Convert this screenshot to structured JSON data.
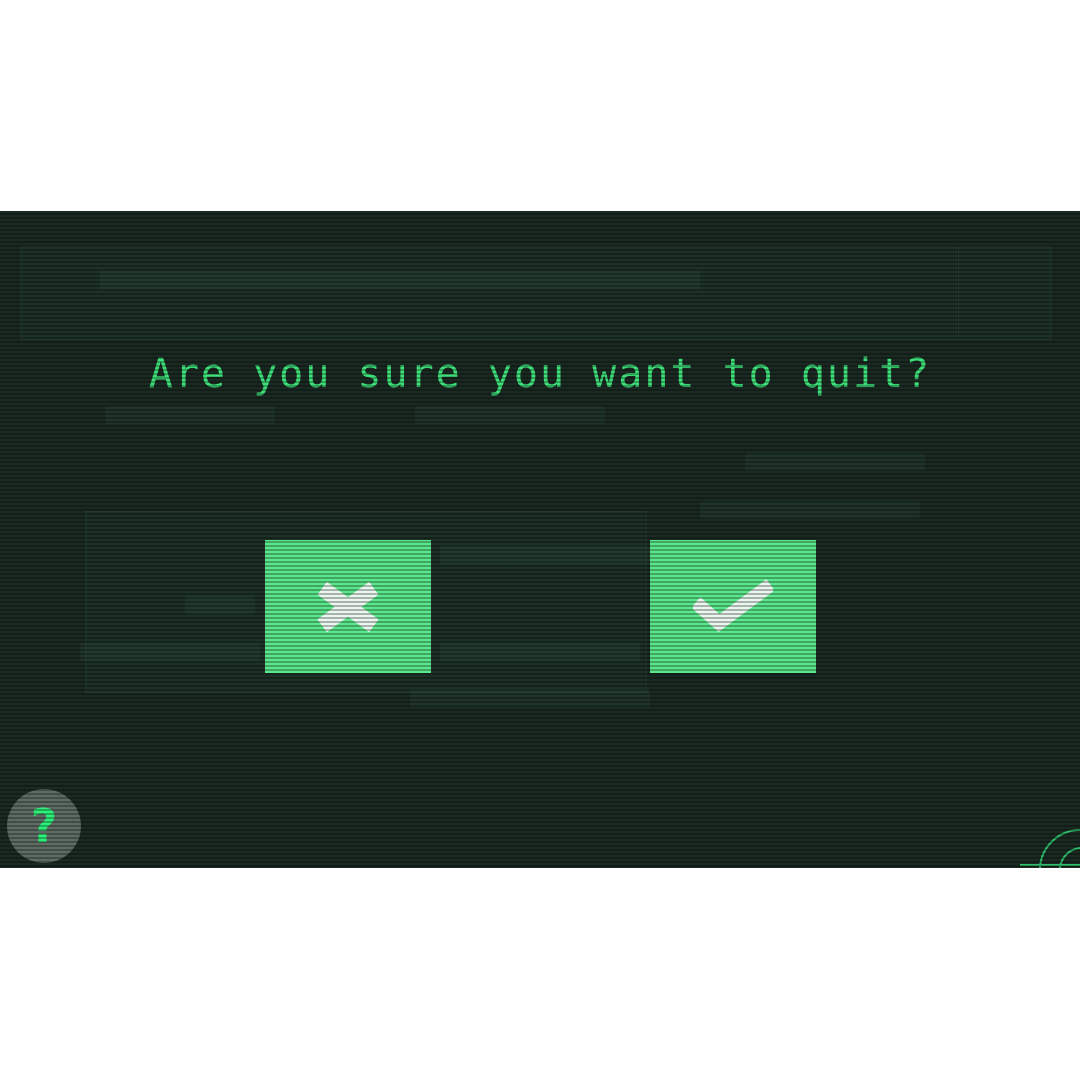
{
  "dialog": {
    "title": "Are you sure you want to quit?",
    "cancel_icon": "close-icon",
    "confirm_icon": "check-icon"
  },
  "help": {
    "glyph": "?",
    "icon": "question-mark-icon"
  },
  "colors": {
    "background": "#1a2a22",
    "accent_text": "#3ee07a",
    "button_fill": "#5ae68a",
    "icon_fill": "#eaf7ef",
    "help_circle": "#5d6b63",
    "help_glyph": "#2cf07a"
  }
}
